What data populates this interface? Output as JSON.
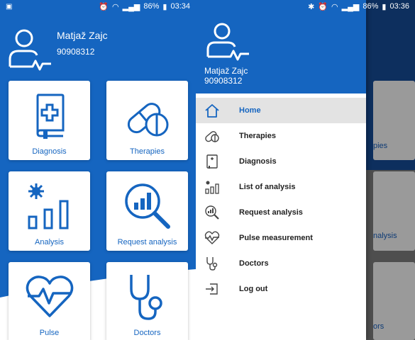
{
  "left": {
    "status": {
      "battery": "86%",
      "time": "03:34"
    },
    "user": {
      "name": "Matjaž Zajc",
      "id": "90908312"
    },
    "tiles": [
      {
        "label": "Diagnosis",
        "icon": "medical-book-icon"
      },
      {
        "label": "Therapies",
        "icon": "pills-icon"
      },
      {
        "label": "Analysis",
        "icon": "bar-chart-icon"
      },
      {
        "label": "Request analysis",
        "icon": "magnifier-chart-icon"
      },
      {
        "label": "Pulse",
        "icon": "heart-pulse-icon"
      },
      {
        "label": "Doctors",
        "icon": "stethoscope-icon"
      }
    ]
  },
  "right": {
    "status": {
      "battery": "86%",
      "time": "03:36"
    },
    "user": {
      "name": "Matjaž Zajc",
      "id": "90908312"
    },
    "menu": [
      {
        "label": "Home",
        "icon": "home-icon",
        "active": true
      },
      {
        "label": "Therapies",
        "icon": "pills-icon"
      },
      {
        "label": "Diagnosis",
        "icon": "medical-book-icon"
      },
      {
        "label": "List of analysis",
        "icon": "bar-chart-icon"
      },
      {
        "label": "Request analysis",
        "icon": "magnifier-chart-icon"
      },
      {
        "label": "Pulse measurement",
        "icon": "heart-pulse-icon"
      },
      {
        "label": "Doctors",
        "icon": "stethoscope-icon"
      },
      {
        "label": "Log out",
        "icon": "logout-icon"
      }
    ],
    "background_fragments": [
      "pies",
      "nalysis",
      "ors"
    ]
  },
  "colors": {
    "primary": "#1565c0",
    "active_bg": "#e3e3e3"
  }
}
